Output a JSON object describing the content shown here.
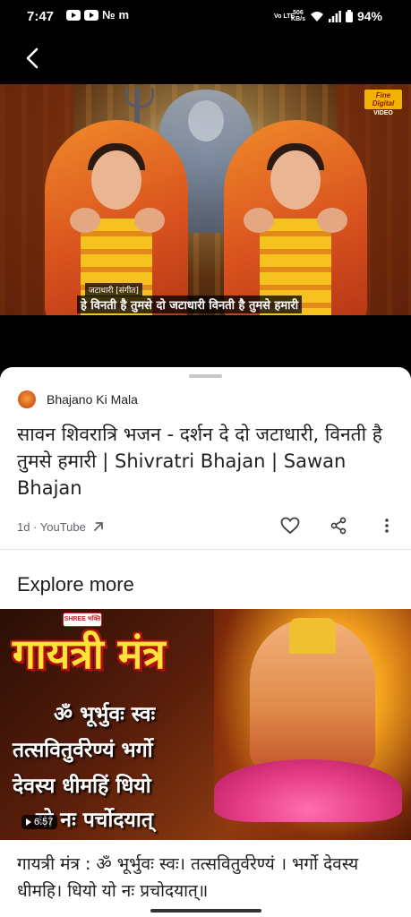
{
  "status_bar": {
    "time": "7:47",
    "mini_glyph_1": "№",
    "mini_glyph_2": "m",
    "volte": "Vo LTE",
    "speed_value": "506",
    "speed_unit": "KB/s",
    "battery": "94%"
  },
  "video": {
    "brand_line": "Fine Digital",
    "brand_sub": "VIDEO",
    "caption_small": "जटाधारी [संगीत]",
    "caption_main": "हे विनती है तुमसे दो जटाधारी विनती है तुमसे हमारी"
  },
  "result": {
    "channel": "Bhajano Ki Mala",
    "title": "सावन शिवरात्रि भजन - दर्शन दे दो जटाधारी, विनती है तुमसे हमारी | Shivratri Bhajan | Sawan Bhajan",
    "meta": "1d · YouTube",
    "icons": [
      "arrow-up-right-icon",
      "heart-icon",
      "share-icon",
      "more-vert-icon"
    ]
  },
  "explore": {
    "heading": "Explore more",
    "thumb": {
      "badge": "SHREE भक्ति",
      "headline": "गायत्री मंत्र",
      "line1": "ॐ भूर्भुवः स्वः",
      "line2": "तत्सवितुर्वरेण्यं भर्गो",
      "line3": "देवस्य धीमहिं धियो",
      "line4": "यो नः पर्चोदयात्",
      "duration": "6:57"
    },
    "title": "गायत्री मंत्र : ॐ भूर्भुवः स्वः। तत्सवितुर्वरेण्यं । भर्गो देवस्य धीमहि। धियो यो नः प्रचोदयात्॥"
  }
}
